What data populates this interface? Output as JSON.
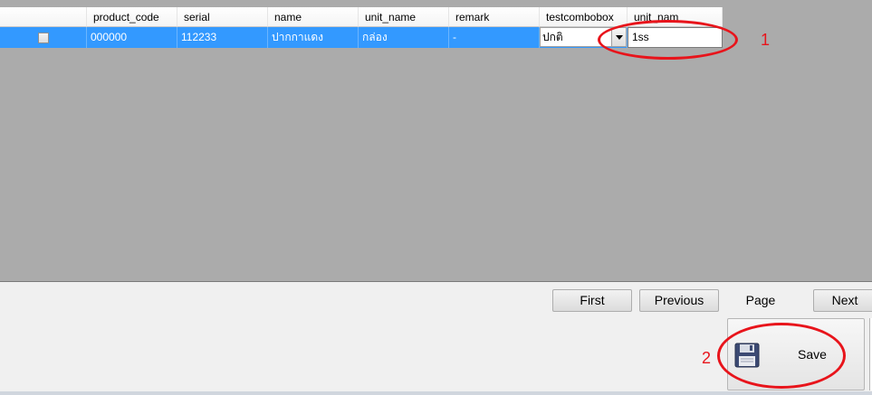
{
  "columns": [
    "",
    "product_code",
    "serial",
    "name",
    "unit_name",
    "remark",
    "testcombobox",
    "unit_nam"
  ],
  "row": {
    "product_code": "000000",
    "serial": "112233",
    "name": "ปากกาแดง",
    "unit_name": "กล่อง",
    "remark": "-",
    "testcombobox": "ปกติ",
    "unit_name_edit": "1ss",
    "checked": false
  },
  "pager": {
    "first": "First",
    "previous": "Previous",
    "page": "Page",
    "next": "Next"
  },
  "save": {
    "label": "Save"
  },
  "annotations": [
    "1",
    "2"
  ],
  "colors": {
    "selection": "#3399ff",
    "grid_background": "#ababab",
    "annotation": "#e8141b"
  }
}
